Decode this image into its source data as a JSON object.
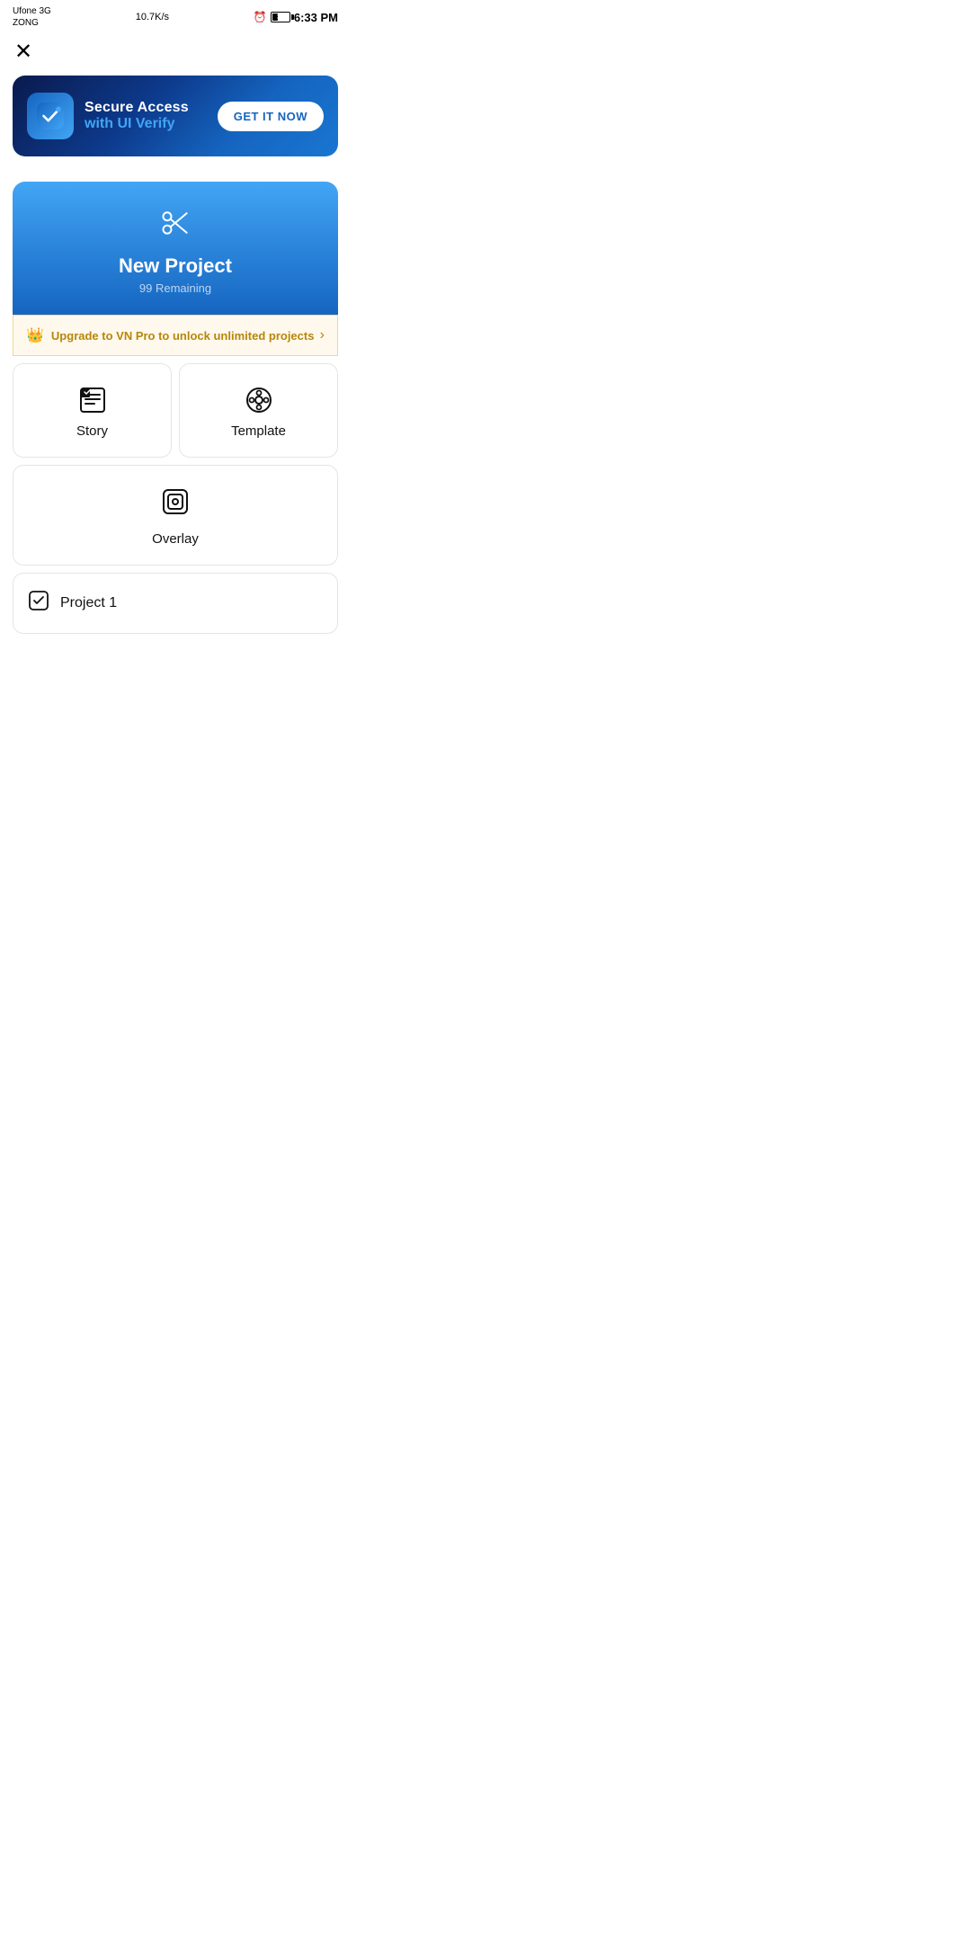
{
  "statusBar": {
    "carrier": "Ufone 3G",
    "carrier2": "ZONG",
    "network": "10.7K/s",
    "time": "6:33 PM",
    "battery": "34"
  },
  "closeButton": {
    "label": "✕"
  },
  "adBanner": {
    "title": "Secure Access",
    "subtitle": "with ",
    "highlight": "UI Verify",
    "cta": "GET IT NOW"
  },
  "newProject": {
    "title": "New Project",
    "subtitle": "99 Remaining"
  },
  "upgradeBanner": {
    "text": "Upgrade to VN Pro to unlock unlimited projects"
  },
  "options": [
    {
      "label": "Story"
    },
    {
      "label": "Template"
    }
  ],
  "overlay": {
    "label": "Overlay"
  },
  "project": {
    "label": "Project 1"
  }
}
